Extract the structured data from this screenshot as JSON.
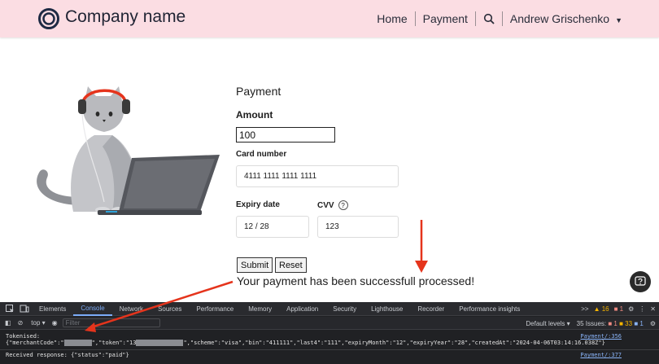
{
  "header": {
    "company": "Company name",
    "nav": [
      "Home",
      "Payment"
    ],
    "user": "Andrew Grischenko",
    "brand_color": "#fbdde3"
  },
  "form": {
    "title": "Payment",
    "amount_label": "Amount",
    "amount_value": "100",
    "card_label": "Card number",
    "card_value": "4111 1111 1111 1111",
    "expiry_label": "Expiry date",
    "expiry_value": "12 / 28",
    "cvv_label": "CVV",
    "cvv_help": "?",
    "cvv_value": "123",
    "submit_label": "Submit",
    "reset_label": "Reset",
    "success_message": "Your payment has been successfull processed!"
  },
  "devtools": {
    "tabs": [
      "Elements",
      "Console",
      "Network",
      "Sources",
      "Performance",
      "Memory",
      "Application",
      "Security",
      "Lighthouse",
      "Recorder",
      "Performance insights"
    ],
    "active_tab": "Console",
    "more": ">>",
    "warn_count": "16",
    "error_count": "1",
    "context": "top",
    "filter_placeholder": "Filter",
    "levels": "Default levels",
    "issues_label": "35 Issues:",
    "issues_err": "1",
    "issues_warn": "33",
    "issues_info": "1",
    "console": {
      "line1": "Tokenised:",
      "line2_a": "{\"merchantCode\":\"",
      "line2_b": "\",\"token\":\"13",
      "line2_c": "\",\"scheme\":\"visa\",\"bin\":\"411111\",\"last4\":\"111\",\"expiryMonth\":\"12\",\"expiryYear\":\"28\",\"createdAt\":\"2024-04-06T03:14:16.038Z\"}",
      "line3": "Received response: {\"status\":\"paid\"}",
      "src1": "Payment/:356",
      "src3": "Payment/:377"
    }
  },
  "colors": {
    "accent": "#7cacf8",
    "arrow": "#e5341c",
    "headphones": "#e5341c"
  }
}
